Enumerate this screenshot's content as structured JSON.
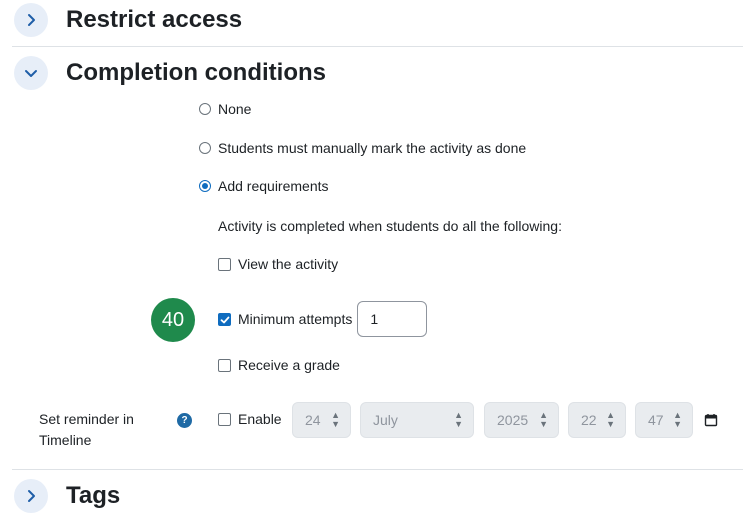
{
  "sections": {
    "restrict": {
      "title": "Restrict access",
      "expanded": false
    },
    "completion": {
      "title": "Completion conditions",
      "expanded": true
    },
    "tags": {
      "title": "Tags",
      "expanded": false
    }
  },
  "completion": {
    "options": [
      {
        "label": "None",
        "selected": false
      },
      {
        "label": "Students must manually mark the activity as done",
        "selected": false
      },
      {
        "label": "Add requirements",
        "selected": true
      }
    ],
    "requirements_intro": "Activity is completed when students do all the following:",
    "view_activity": {
      "label": "View the activity",
      "checked": false
    },
    "minimum_attempts": {
      "label": "Minimum attempts",
      "checked": true,
      "value": "1"
    },
    "receive_grade": {
      "label": "Receive a grade",
      "checked": false
    },
    "step_badge": "40"
  },
  "reminder": {
    "label_line1": "Set reminder in",
    "label_line2": "Timeline",
    "help_icon": "?",
    "enable_label": "Enable",
    "enabled": false,
    "day": "24",
    "month": "July",
    "year": "2025",
    "hour": "22",
    "minute": "47"
  },
  "colors": {
    "accent": "#0f6cbf",
    "badge": "#1f8a4c",
    "chevron_bg": "#e7eef8"
  }
}
